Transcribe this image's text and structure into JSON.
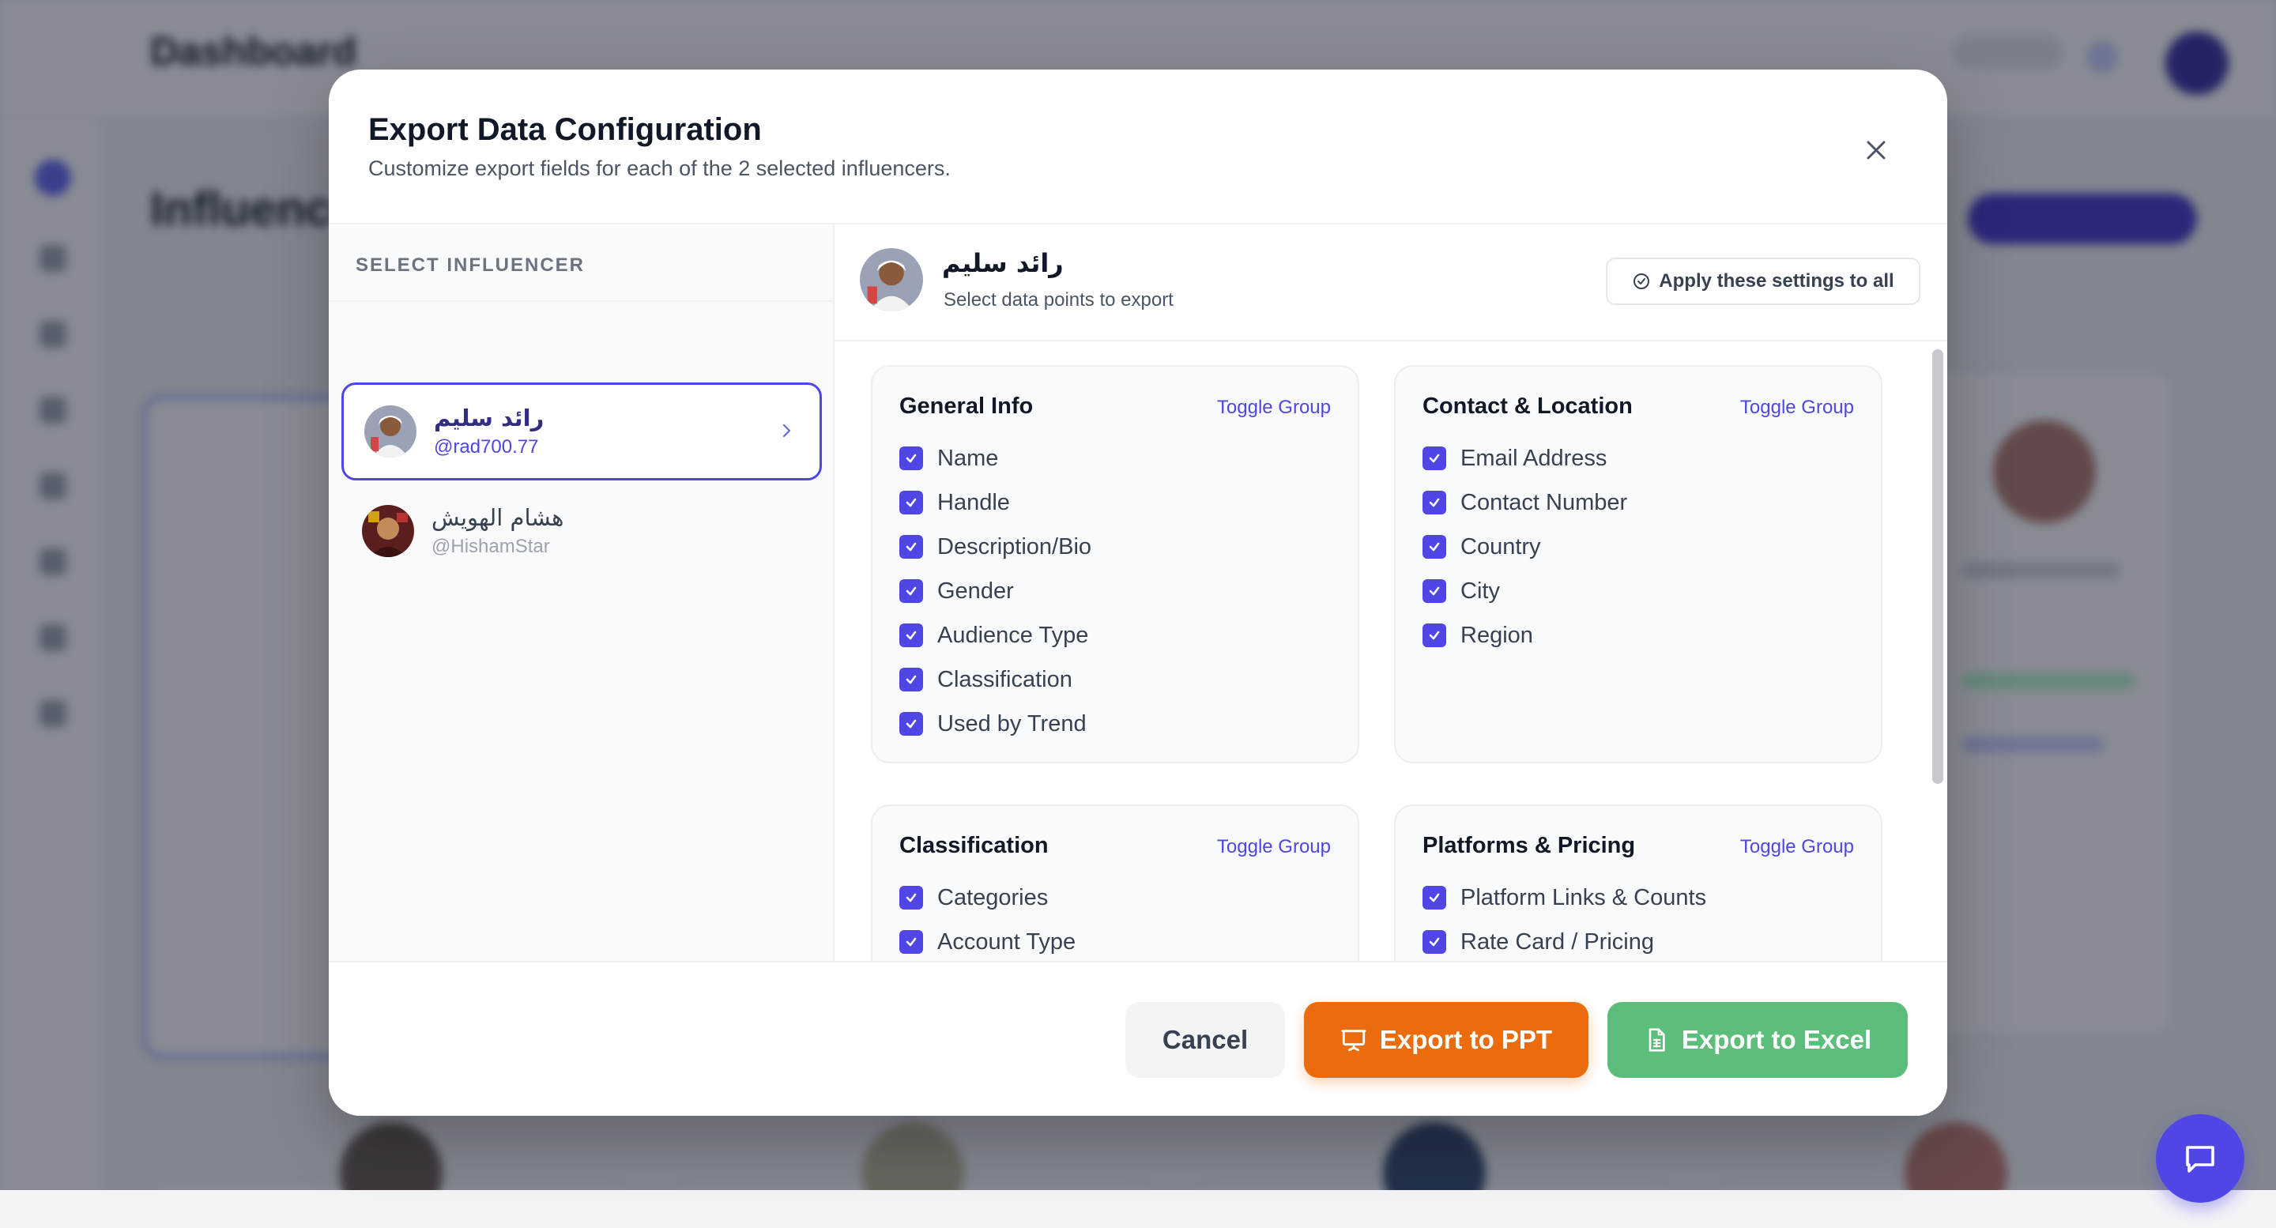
{
  "background": {
    "brand": "Dashboard",
    "page_title": "Influencers"
  },
  "modal": {
    "title": "Export Data Configuration",
    "subtitle": "Customize export fields for each of the 2 selected influencers.",
    "close_icon": "close-icon",
    "left_panel": {
      "heading": "SELECT INFLUENCER",
      "influencers": [
        {
          "name": "رائد سليم",
          "handle": "@rad700.77",
          "selected": true
        },
        {
          "name": "هشام الهويش",
          "handle": "@HishamStar",
          "selected": false
        }
      ]
    },
    "right_panel": {
      "name": "رائد سليم",
      "subtitle": "Select data points to export",
      "apply_all_label": "Apply these settings to all",
      "apply_icon": "check-circle-icon",
      "toggle_label": "Toggle Group",
      "groups": [
        {
          "title": "General Info",
          "fields": [
            "Name",
            "Handle",
            "Description/Bio",
            "Gender",
            "Audience Type",
            "Classification",
            "Used by Trend"
          ]
        },
        {
          "title": "Contact & Location",
          "fields": [
            "Email Address",
            "Contact Number",
            "Country",
            "City",
            "Region"
          ]
        },
        {
          "title": "Classification",
          "fields": [
            "Categories",
            "Account Type"
          ]
        },
        {
          "title": "Platforms & Pricing",
          "fields": [
            "Platform Links & Counts",
            "Rate Card / Pricing"
          ]
        }
      ]
    },
    "footer": {
      "cancel_label": "Cancel",
      "ppt_label": "Export to PPT",
      "ppt_icon": "presentation-icon",
      "excel_label": "Export to Excel",
      "excel_icon": "spreadsheet-file-icon"
    }
  },
  "chat_button_icon": "chat-bubble-icon",
  "colors": {
    "accent": "#4f46e5",
    "ppt": "#ea6c0c",
    "excel": "#5dbd7b"
  }
}
